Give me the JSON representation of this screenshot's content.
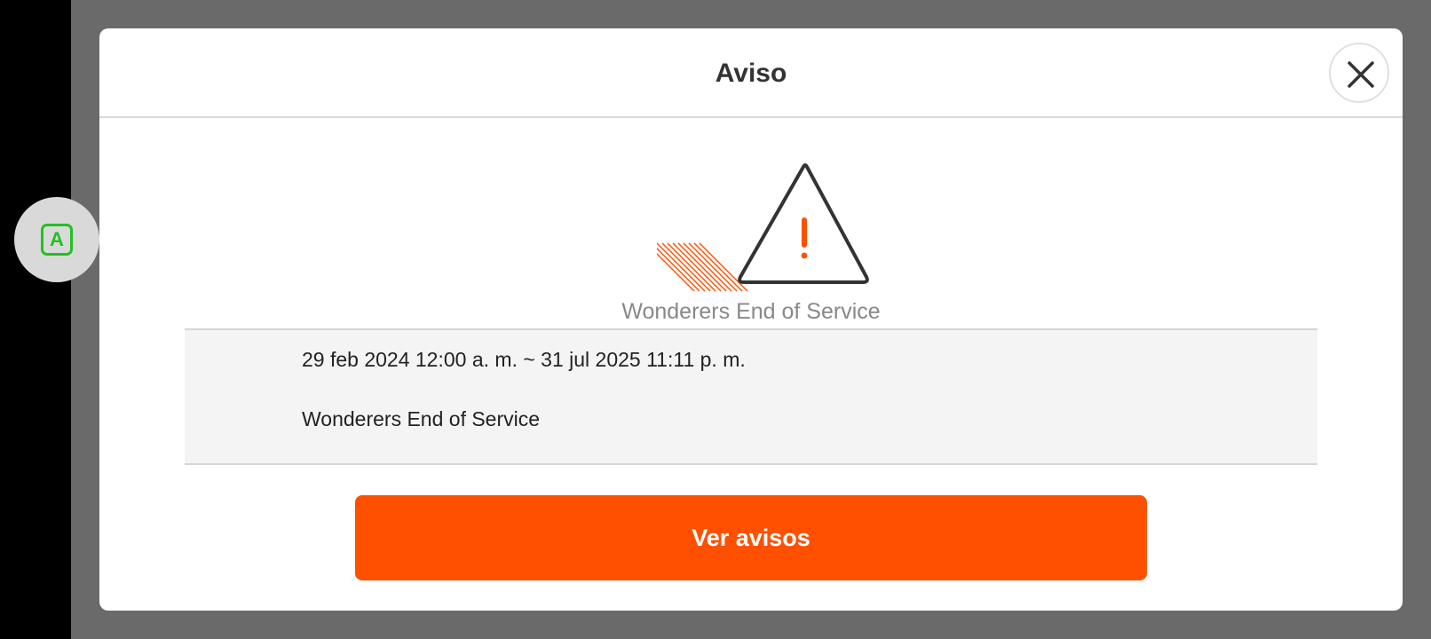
{
  "dialog": {
    "title": "Aviso",
    "close_icon": "close-icon",
    "warning_icon": "warning-triangle-icon",
    "subtitle": "Wonderers End of Service"
  },
  "notice": {
    "date_range": "29 feb 2024 12:00 a. m. ~ 31 jul 2025 11:11 p. m.",
    "text": "Wonderers End of Service"
  },
  "actions": {
    "view_notices_label": "Ver avisos"
  },
  "assist": {
    "icon": "assistant-a-icon",
    "letter": "A"
  },
  "colors": {
    "accent": "#ff5000",
    "assist_green": "#22c022"
  }
}
